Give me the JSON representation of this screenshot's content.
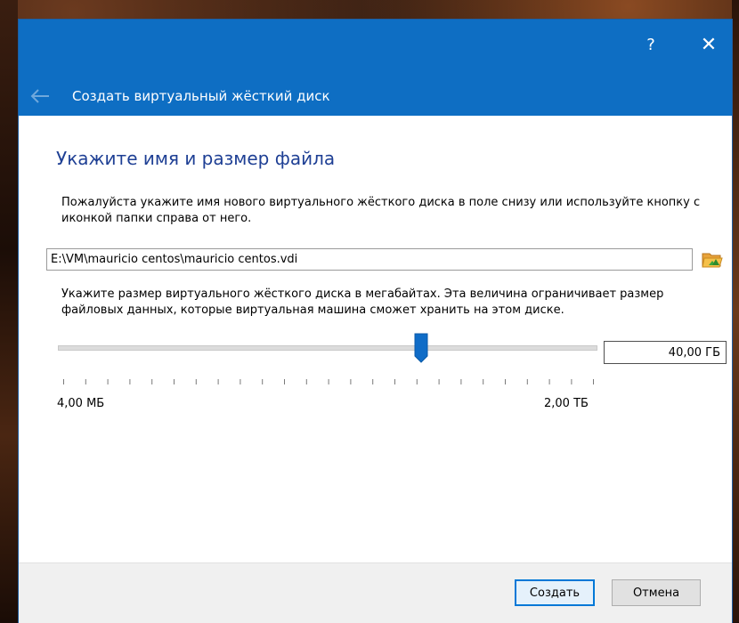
{
  "window": {
    "help_label": "?",
    "close_label": "✕",
    "back_icon": "back-arrow-icon",
    "title": "Создать виртуальный жёсткий диск",
    "accent_color": "#0e6ec3"
  },
  "page": {
    "heading": "Укажите имя и размер файла",
    "file_instructions": "Пожалуйста укажите имя нового виртуального жёсткого диска в поле снизу или используйте кнопку с иконкой папки справа от него.",
    "file_path": "E:\\VM\\mauricio centos\\mauricio centos.vdi",
    "folder_icon": "folder-open-icon",
    "size_instructions": "Укажите размер виртуального жёсткого диска в мегабайтах. Эта величина ограничивает размер файловых данных, которые виртуальная машина сможет хранить на этом диске.",
    "size_value": "40,00 ГБ",
    "slider_position_fraction": 0.675,
    "slider_min_label": "4,00 МБ",
    "slider_max_label": "2,00 ТБ"
  },
  "footer": {
    "create_label": "Создать",
    "cancel_label": "Отмена"
  }
}
